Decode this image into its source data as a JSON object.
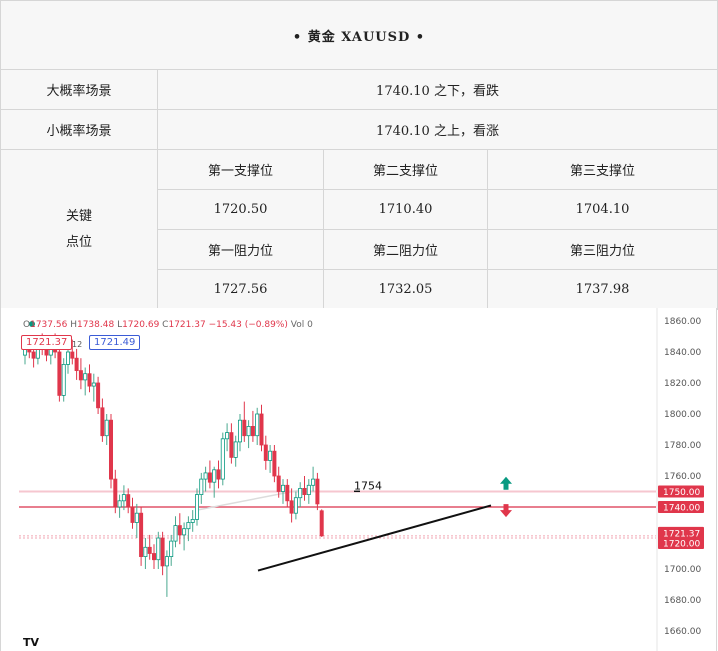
{
  "header": {
    "title": "•  黄金 XAUUSD  •"
  },
  "scenarios": [
    {
      "label": "大概率场景",
      "text": "1740.10 之下，看跌"
    },
    {
      "label": "小概率场景",
      "text": "1740.10 之上，看涨"
    }
  ],
  "levels": {
    "label_line1": "关键",
    "label_line2": "点位",
    "support_headers": [
      "第一支撑位",
      "第二支撑位",
      "第三支撑位"
    ],
    "support_values": [
      "1720.50",
      "1710.40",
      "1704.10"
    ],
    "resistance_headers": [
      "第一阻力位",
      "第二阻力位",
      "第三阻力位"
    ],
    "resistance_values": [
      "1727.56",
      "1732.05",
      "1737.98"
    ]
  },
  "legend": {
    "open": "1737.56",
    "high": "1738.48",
    "low": "1720.69",
    "close": "1721.37",
    "change": "−15.43 (−0.89%)",
    "vol": "Vol 0"
  },
  "badges": {
    "bid": "1721.37",
    "ask": "1721.49",
    "mid_marker": "12"
  },
  "tv_logo": "TV",
  "chart_data": {
    "type": "candlestick",
    "ylim": [
      1655,
      1865
    ],
    "yticks": [
      1660,
      1680,
      1700,
      1720,
      1740,
      1760,
      1780,
      1800,
      1820,
      1840,
      1860
    ],
    "ytick_labels": [
      "1660.00",
      "1680.00",
      "1700.00",
      "1720.00",
      "1740.00",
      "1760.00",
      "1780.00",
      "1800.00",
      "1820.00",
      "1840.00",
      "1860.00"
    ],
    "price_tags": [
      {
        "value": 1750,
        "label": "1750.00"
      },
      {
        "value": 1740,
        "label": "1740.00"
      },
      {
        "value": 1721.37,
        "label": "1721.37"
      },
      {
        "value": 1720,
        "label": "1720.00"
      }
    ],
    "hlines": [
      1750,
      1740,
      1720
    ],
    "annotation": {
      "label": "1754",
      "value": 1754
    },
    "trendline": {
      "from": [
        11,
        1699
      ],
      "to": [
        75,
        1741
      ]
    },
    "arrows": [
      {
        "direction": "up",
        "at": 78,
        "value": 1755,
        "color": "#089981"
      },
      {
        "direction": "down",
        "at": 78,
        "value": 1738,
        "color": "#e0364b"
      }
    ],
    "candles": [
      {
        "i": 0,
        "o": 1838,
        "h": 1846,
        "l": 1832,
        "c": 1842
      },
      {
        "i": 1,
        "o": 1842,
        "h": 1848,
        "l": 1836,
        "c": 1840
      },
      {
        "i": 2,
        "o": 1840,
        "h": 1845,
        "l": 1830,
        "c": 1836
      },
      {
        "i": 3,
        "o": 1836,
        "h": 1850,
        "l": 1832,
        "c": 1846
      },
      {
        "i": 4,
        "o": 1846,
        "h": 1852,
        "l": 1838,
        "c": 1842
      },
      {
        "i": 5,
        "o": 1842,
        "h": 1848,
        "l": 1834,
        "c": 1838
      },
      {
        "i": 6,
        "o": 1838,
        "h": 1849,
        "l": 1832,
        "c": 1844
      },
      {
        "i": 7,
        "o": 1844,
        "h": 1852,
        "l": 1836,
        "c": 1840
      },
      {
        "i": 8,
        "o": 1840,
        "h": 1846,
        "l": 1808,
        "c": 1812
      },
      {
        "i": 9,
        "o": 1812,
        "h": 1836,
        "l": 1808,
        "c": 1832
      },
      {
        "i": 10,
        "o": 1832,
        "h": 1846,
        "l": 1826,
        "c": 1840
      },
      {
        "i": 11,
        "o": 1840,
        "h": 1848,
        "l": 1832,
        "c": 1836
      },
      {
        "i": 12,
        "o": 1836,
        "h": 1842,
        "l": 1822,
        "c": 1828
      },
      {
        "i": 13,
        "o": 1828,
        "h": 1836,
        "l": 1816,
        "c": 1822
      },
      {
        "i": 14,
        "o": 1822,
        "h": 1830,
        "l": 1812,
        "c": 1826
      },
      {
        "i": 15,
        "o": 1826,
        "h": 1832,
        "l": 1814,
        "c": 1818
      },
      {
        "i": 16,
        "o": 1818,
        "h": 1826,
        "l": 1808,
        "c": 1820
      },
      {
        "i": 17,
        "o": 1820,
        "h": 1824,
        "l": 1800,
        "c": 1804
      },
      {
        "i": 18,
        "o": 1804,
        "h": 1810,
        "l": 1782,
        "c": 1786
      },
      {
        "i": 19,
        "o": 1786,
        "h": 1800,
        "l": 1780,
        "c": 1796
      },
      {
        "i": 20,
        "o": 1796,
        "h": 1800,
        "l": 1752,
        "c": 1758
      },
      {
        "i": 21,
        "o": 1758,
        "h": 1764,
        "l": 1736,
        "c": 1740
      },
      {
        "i": 22,
        "o": 1740,
        "h": 1748,
        "l": 1733,
        "c": 1744
      },
      {
        "i": 23,
        "o": 1744,
        "h": 1754,
        "l": 1738,
        "c": 1748
      },
      {
        "i": 24,
        "o": 1748,
        "h": 1752,
        "l": 1736,
        "c": 1740
      },
      {
        "i": 25,
        "o": 1740,
        "h": 1746,
        "l": 1726,
        "c": 1730
      },
      {
        "i": 26,
        "o": 1730,
        "h": 1742,
        "l": 1720,
        "c": 1736
      },
      {
        "i": 27,
        "o": 1736,
        "h": 1740,
        "l": 1702,
        "c": 1708
      },
      {
        "i": 28,
        "o": 1708,
        "h": 1720,
        "l": 1700,
        "c": 1714
      },
      {
        "i": 29,
        "o": 1714,
        "h": 1722,
        "l": 1706,
        "c": 1710
      },
      {
        "i": 30,
        "o": 1710,
        "h": 1716,
        "l": 1700,
        "c": 1706
      },
      {
        "i": 31,
        "o": 1706,
        "h": 1724,
        "l": 1700,
        "c": 1720
      },
      {
        "i": 32,
        "o": 1720,
        "h": 1724,
        "l": 1696,
        "c": 1702
      },
      {
        "i": 33,
        "o": 1702,
        "h": 1712,
        "l": 1682,
        "c": 1708
      },
      {
        "i": 34,
        "o": 1708,
        "h": 1722,
        "l": 1702,
        "c": 1718
      },
      {
        "i": 35,
        "o": 1718,
        "h": 1734,
        "l": 1714,
        "c": 1728
      },
      {
        "i": 36,
        "o": 1728,
        "h": 1736,
        "l": 1716,
        "c": 1722
      },
      {
        "i": 37,
        "o": 1722,
        "h": 1730,
        "l": 1712,
        "c": 1726
      },
      {
        "i": 38,
        "o": 1726,
        "h": 1734,
        "l": 1718,
        "c": 1730
      },
      {
        "i": 39,
        "o": 1730,
        "h": 1738,
        "l": 1724,
        "c": 1732
      },
      {
        "i": 40,
        "o": 1732,
        "h": 1752,
        "l": 1728,
        "c": 1748
      },
      {
        "i": 41,
        "o": 1748,
        "h": 1762,
        "l": 1742,
        "c": 1758
      },
      {
        "i": 42,
        "o": 1758,
        "h": 1766,
        "l": 1750,
        "c": 1762
      },
      {
        "i": 43,
        "o": 1762,
        "h": 1770,
        "l": 1752,
        "c": 1756
      },
      {
        "i": 44,
        "o": 1756,
        "h": 1766,
        "l": 1746,
        "c": 1764
      },
      {
        "i": 45,
        "o": 1764,
        "h": 1770,
        "l": 1752,
        "c": 1758
      },
      {
        "i": 46,
        "o": 1758,
        "h": 1788,
        "l": 1754,
        "c": 1784
      },
      {
        "i": 47,
        "o": 1784,
        "h": 1794,
        "l": 1776,
        "c": 1788
      },
      {
        "i": 48,
        "o": 1788,
        "h": 1794,
        "l": 1768,
        "c": 1772
      },
      {
        "i": 49,
        "o": 1772,
        "h": 1786,
        "l": 1766,
        "c": 1782
      },
      {
        "i": 50,
        "o": 1782,
        "h": 1800,
        "l": 1776,
        "c": 1796
      },
      {
        "i": 51,
        "o": 1796,
        "h": 1808,
        "l": 1782,
        "c": 1786
      },
      {
        "i": 52,
        "o": 1786,
        "h": 1796,
        "l": 1778,
        "c": 1792
      },
      {
        "i": 53,
        "o": 1792,
        "h": 1802,
        "l": 1782,
        "c": 1786
      },
      {
        "i": 54,
        "o": 1786,
        "h": 1804,
        "l": 1780,
        "c": 1800
      },
      {
        "i": 55,
        "o": 1800,
        "h": 1806,
        "l": 1776,
        "c": 1780
      },
      {
        "i": 56,
        "o": 1780,
        "h": 1786,
        "l": 1764,
        "c": 1770
      },
      {
        "i": 57,
        "o": 1770,
        "h": 1780,
        "l": 1762,
        "c": 1776
      },
      {
        "i": 58,
        "o": 1776,
        "h": 1780,
        "l": 1756,
        "c": 1760
      },
      {
        "i": 59,
        "o": 1760,
        "h": 1766,
        "l": 1746,
        "c": 1750
      },
      {
        "i": 60,
        "o": 1750,
        "h": 1758,
        "l": 1742,
        "c": 1754
      },
      {
        "i": 61,
        "o": 1754,
        "h": 1758,
        "l": 1740,
        "c": 1744
      },
      {
        "i": 62,
        "o": 1744,
        "h": 1752,
        "l": 1730,
        "c": 1736
      },
      {
        "i": 63,
        "o": 1736,
        "h": 1750,
        "l": 1732,
        "c": 1746
      },
      {
        "i": 64,
        "o": 1746,
        "h": 1756,
        "l": 1740,
        "c": 1752
      },
      {
        "i": 65,
        "o": 1752,
        "h": 1760,
        "l": 1744,
        "c": 1748
      },
      {
        "i": 66,
        "o": 1748,
        "h": 1758,
        "l": 1742,
        "c": 1754
      },
      {
        "i": 67,
        "o": 1754,
        "h": 1766,
        "l": 1750,
        "c": 1758
      },
      {
        "i": 68,
        "o": 1758,
        "h": 1762,
        "l": 1738,
        "c": 1742
      },
      {
        "i": 69,
        "o": 1737.56,
        "h": 1738.48,
        "l": 1720.69,
        "c": 1721.37
      }
    ]
  }
}
